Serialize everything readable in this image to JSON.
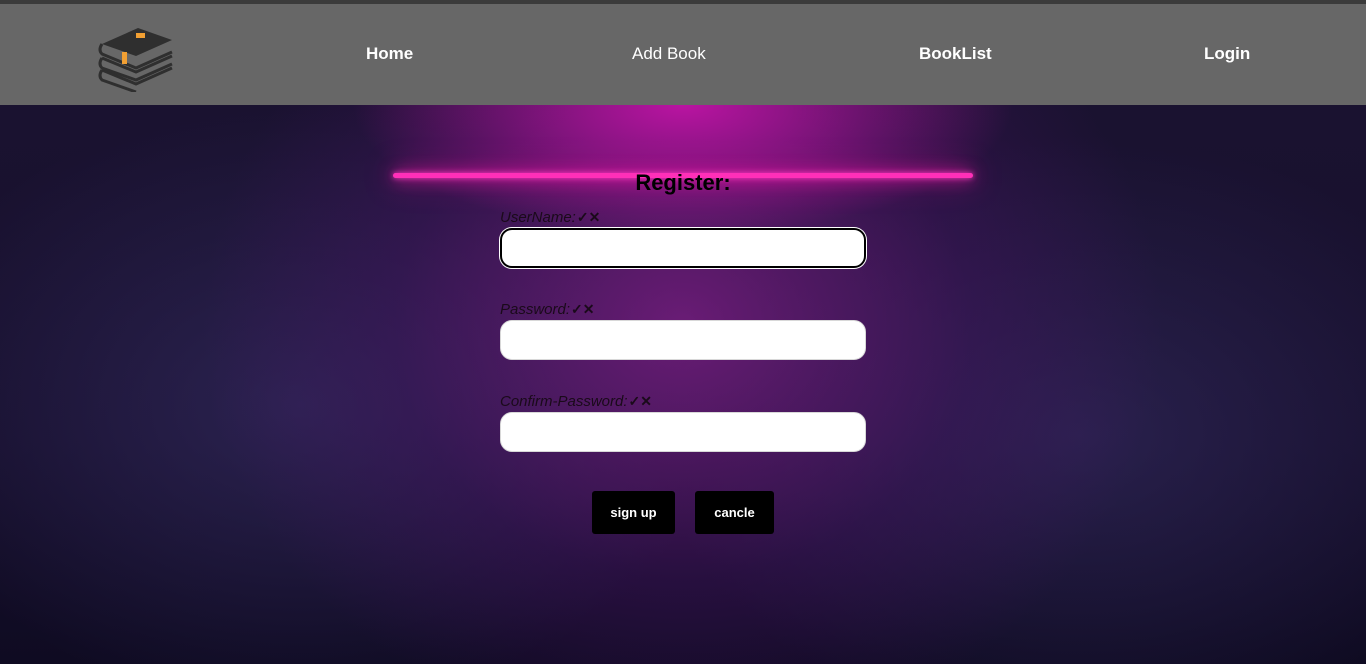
{
  "nav": {
    "logo_icon": "book-stack-icon",
    "links": [
      {
        "label": "Home"
      },
      {
        "label": "Add Book"
      },
      {
        "label": "BookList"
      },
      {
        "label": "Login"
      }
    ]
  },
  "form": {
    "title": "Register:",
    "fields": [
      {
        "label": "UserName:",
        "marks": "✓✕",
        "value": "",
        "placeholder": ""
      },
      {
        "label": "Password:",
        "marks": "✓✕",
        "value": "",
        "placeholder": ""
      },
      {
        "label": "Confirm-Password:",
        "marks": "✓✕",
        "value": "",
        "placeholder": ""
      }
    ],
    "signup_label": "sign up",
    "cancel_label": "cancle"
  },
  "colors": {
    "navbar": "#676767",
    "neon": "#ff2fb8",
    "button": "#000000"
  }
}
